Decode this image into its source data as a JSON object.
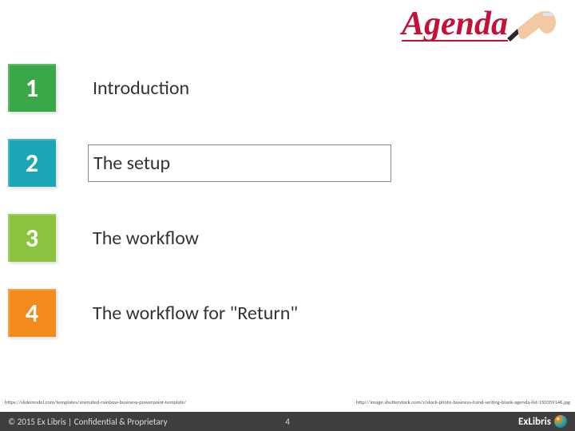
{
  "header": {
    "agenda_word": "Agenda"
  },
  "items": [
    {
      "num": "1",
      "label": "Introduction",
      "color": "c1",
      "highlight": false
    },
    {
      "num": "2",
      "label": "The setup",
      "color": "c2",
      "highlight": true
    },
    {
      "num": "3",
      "label": "The workflow",
      "color": "c3",
      "highlight": false
    },
    {
      "num": "4",
      "label": "The workflow for \"Return\"",
      "color": "c4",
      "highlight": false
    }
  ],
  "footer_links": {
    "left": "https://slidemodel.com/templates/animated-rainbow-business-powerpoint-template/",
    "right": "http://image.shutterstock.com/z/stock-photo-business-hand-writing-blank-agenda-list-150359146.jpg"
  },
  "footer": {
    "copyright": "© 2015 Ex Libris | Confidential & Proprietary",
    "page": "4",
    "logo_text": "ExLibris"
  }
}
